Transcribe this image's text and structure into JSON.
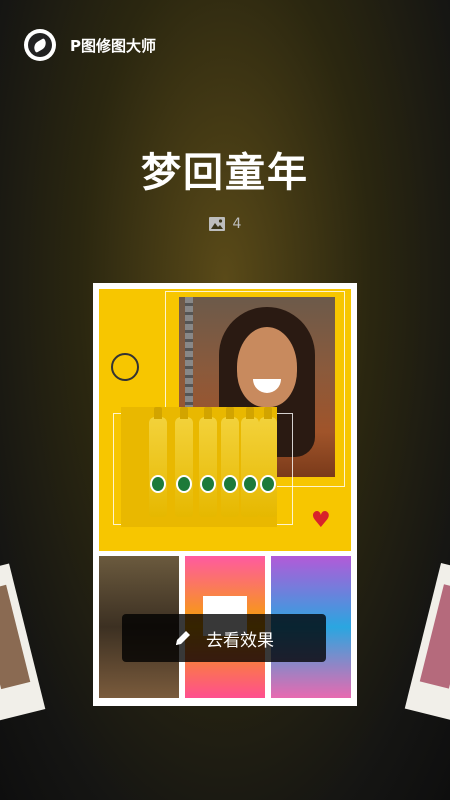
{
  "header": {
    "app_name": "P图修图大师",
    "logo_icon": "app-logo-icon"
  },
  "album": {
    "title": "梦回童年",
    "image_count": "4",
    "count_icon": "image-icon"
  },
  "cta": {
    "label": "去看效果",
    "icon": "pencil-icon"
  },
  "colors": {
    "accent_yellow": "#f7c600",
    "cta_background": "#000000",
    "text_primary": "#ffffff",
    "text_secondary": "#bdbdbd"
  }
}
